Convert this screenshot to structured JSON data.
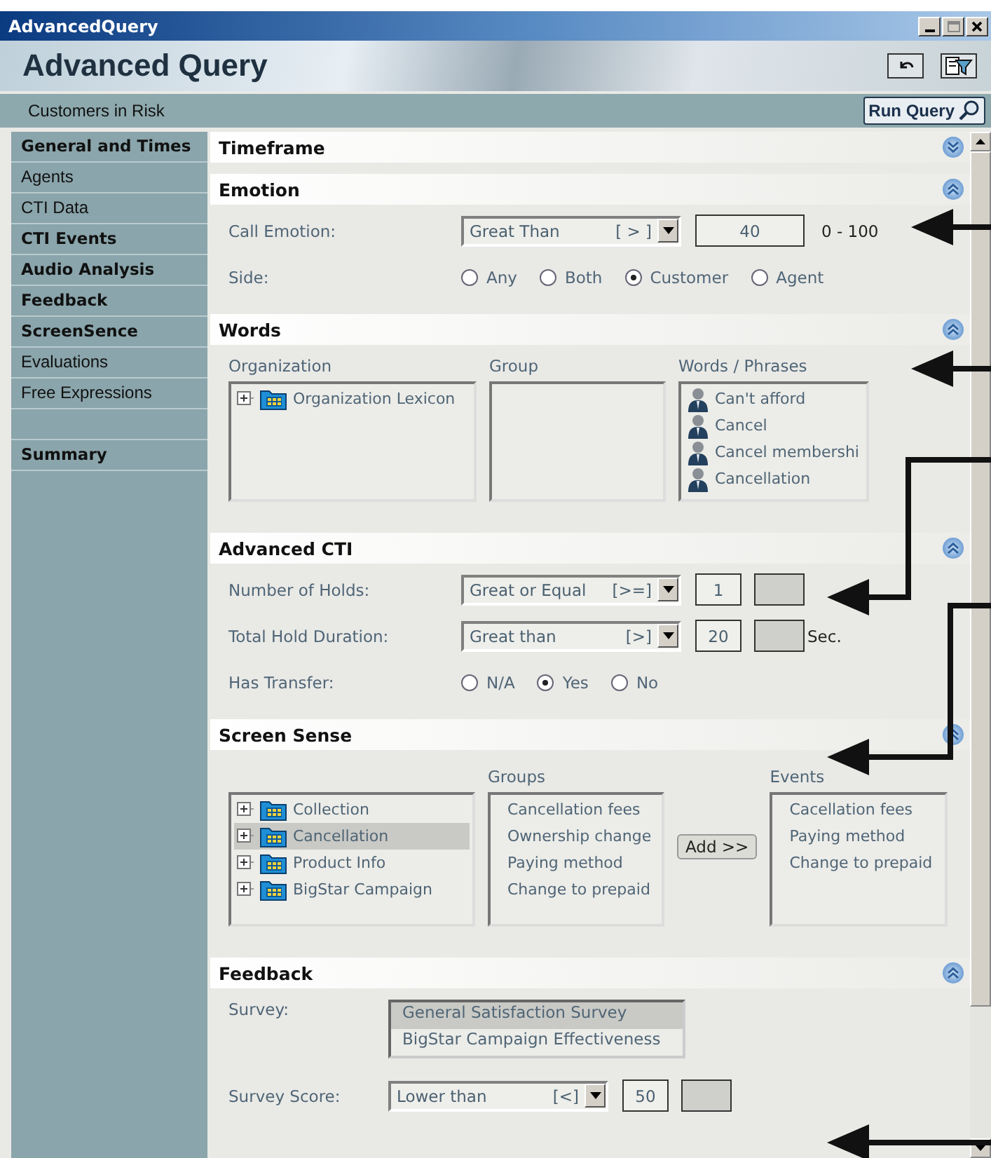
{
  "window": {
    "title": "AdvancedQuery"
  },
  "header": {
    "title": "Advanced Query"
  },
  "query_bar": {
    "name": "Customers in Risk",
    "run_button": "Run Query"
  },
  "sidebar": {
    "items": [
      {
        "label": "General and Times",
        "bold": true
      },
      {
        "label": "Agents",
        "bold": false
      },
      {
        "label": "CTI Data",
        "bold": false
      },
      {
        "label": "CTI Events",
        "bold": true
      },
      {
        "label": "Audio Analysis",
        "bold": true
      },
      {
        "label": "Feedback",
        "bold": true
      },
      {
        "label": "ScreenSence",
        "bold": true
      },
      {
        "label": "Evaluations",
        "bold": false
      },
      {
        "label": "Free Expressions",
        "bold": false
      }
    ],
    "footer_items": [
      {
        "label": "Summary",
        "bold": true
      }
    ]
  },
  "sections": [
    {
      "title": "Timeframe",
      "expanded": false
    },
    {
      "title": "Emotion",
      "expanded": true,
      "blocks": [
        {
          "kind": "condition",
          "label": "Call Emotion:",
          "operator": "Great Than",
          "symbol": "[ > ]",
          "value": "40",
          "extra_box": false,
          "note": "0 - 100"
        },
        {
          "kind": "radios",
          "label": "Side:",
          "options": [
            {
              "label": "Any",
              "selected": false
            },
            {
              "label": "Both",
              "selected": false
            },
            {
              "label": "Customer",
              "selected": true
            },
            {
              "label": "Agent",
              "selected": false
            }
          ]
        }
      ]
    },
    {
      "title": "Words",
      "expanded": true,
      "blocks": [
        {
          "kind": "lists",
          "columns": [
            {
              "kind": "list",
              "label": "Organization",
              "items": [
                {
                  "kind": "folder",
                  "text": "Organization Lexicon"
                }
              ]
            },
            {
              "kind": "list",
              "label": "Group"
            },
            {
              "kind": "list",
              "label": "Words / Phrases",
              "items": [
                {
                  "kind": "person",
                  "text": "Can't afford"
                },
                {
                  "kind": "person",
                  "text": "Cancel"
                },
                {
                  "kind": "person",
                  "text": "Cancel membershi"
                },
                {
                  "kind": "person",
                  "text": "Cancellation"
                }
              ]
            }
          ]
        }
      ]
    },
    {
      "title": "Advanced CTI",
      "expanded": true,
      "blocks": [
        {
          "kind": "condition",
          "label": "Number of Holds:",
          "operator": "Great or Equal",
          "symbol": "[>=]",
          "value": "1",
          "extra_box": true
        },
        {
          "kind": "condition",
          "label": "Total Hold Duration:",
          "operator": "Great than",
          "symbol": "[>]",
          "value": "20",
          "extra_box": true,
          "unit": "Sec."
        },
        {
          "kind": "radios",
          "label": "Has Transfer:",
          "options": [
            {
              "label": "N/A",
              "selected": false
            },
            {
              "label": "Yes",
              "selected": true
            },
            {
              "label": "No",
              "selected": false
            }
          ]
        }
      ]
    },
    {
      "title": "Screen Sense",
      "expanded": true,
      "blocks": [
        {
          "kind": "lists",
          "columns": [
            {
              "kind": "list",
              "items": [
                {
                  "kind": "folder",
                  "text": "Collection",
                  "selected": false
                },
                {
                  "kind": "folder",
                  "text": "Cancellation",
                  "selected": true
                },
                {
                  "kind": "folder",
                  "text": "Product Info",
                  "selected": false
                },
                {
                  "kind": "folder",
                  "text": "BigStar Campaign",
                  "selected": false
                }
              ]
            },
            {
              "kind": "list",
              "label": "Groups",
              "items": [
                {
                  "kind": "text",
                  "text": "Cancellation fees"
                },
                {
                  "kind": "text",
                  "text": "Ownership change"
                },
                {
                  "kind": "text",
                  "text": "Paying method"
                },
                {
                  "kind": "text",
                  "text": "Change to prepaid"
                }
              ]
            },
            {
              "kind": "button",
              "label": "Add >>"
            },
            {
              "kind": "list",
              "label": "Events",
              "items": [
                {
                  "kind": "text",
                  "text": "Cacellation fees"
                },
                {
                  "kind": "text",
                  "text": "Paying method"
                },
                {
                  "kind": "text",
                  "text": "Change to prepaid"
                }
              ]
            }
          ]
        }
      ]
    },
    {
      "title": "Feedback",
      "expanded": true,
      "blocks": [
        {
          "kind": "listbox",
          "label": "Survey:",
          "items": [
            {
              "text": "General Satisfaction Survey",
              "selected": true
            },
            {
              "text": "BigStar Campaign Effectiveness",
              "selected": false
            }
          ]
        },
        {
          "kind": "condition",
          "label": "Survey Score:",
          "operator": "Lower than",
          "symbol": "[<]",
          "value": "50",
          "extra_box": true
        }
      ]
    }
  ]
}
